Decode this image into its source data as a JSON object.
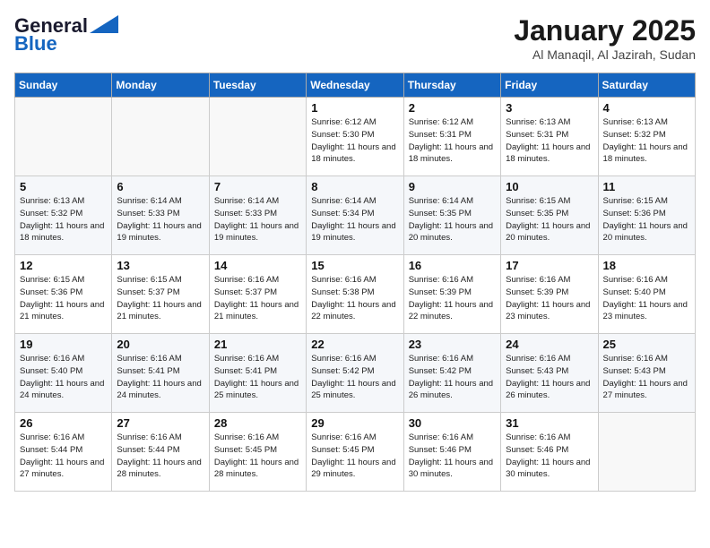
{
  "header": {
    "logo_line1": "General",
    "logo_line2": "Blue",
    "month": "January 2025",
    "location": "Al Manaqil, Al Jazirah, Sudan"
  },
  "weekdays": [
    "Sunday",
    "Monday",
    "Tuesday",
    "Wednesday",
    "Thursday",
    "Friday",
    "Saturday"
  ],
  "weeks": [
    [
      {
        "day": "",
        "empty": true
      },
      {
        "day": "",
        "empty": true
      },
      {
        "day": "",
        "empty": true
      },
      {
        "day": "1",
        "sunrise": "6:12 AM",
        "sunset": "5:30 PM",
        "daylight": "11 hours and 18 minutes."
      },
      {
        "day": "2",
        "sunrise": "6:12 AM",
        "sunset": "5:31 PM",
        "daylight": "11 hours and 18 minutes."
      },
      {
        "day": "3",
        "sunrise": "6:13 AM",
        "sunset": "5:31 PM",
        "daylight": "11 hours and 18 minutes."
      },
      {
        "day": "4",
        "sunrise": "6:13 AM",
        "sunset": "5:32 PM",
        "daylight": "11 hours and 18 minutes."
      }
    ],
    [
      {
        "day": "5",
        "sunrise": "6:13 AM",
        "sunset": "5:32 PM",
        "daylight": "11 hours and 18 minutes."
      },
      {
        "day": "6",
        "sunrise": "6:14 AM",
        "sunset": "5:33 PM",
        "daylight": "11 hours and 19 minutes."
      },
      {
        "day": "7",
        "sunrise": "6:14 AM",
        "sunset": "5:33 PM",
        "daylight": "11 hours and 19 minutes."
      },
      {
        "day": "8",
        "sunrise": "6:14 AM",
        "sunset": "5:34 PM",
        "daylight": "11 hours and 19 minutes."
      },
      {
        "day": "9",
        "sunrise": "6:14 AM",
        "sunset": "5:35 PM",
        "daylight": "11 hours and 20 minutes."
      },
      {
        "day": "10",
        "sunrise": "6:15 AM",
        "sunset": "5:35 PM",
        "daylight": "11 hours and 20 minutes."
      },
      {
        "day": "11",
        "sunrise": "6:15 AM",
        "sunset": "5:36 PM",
        "daylight": "11 hours and 20 minutes."
      }
    ],
    [
      {
        "day": "12",
        "sunrise": "6:15 AM",
        "sunset": "5:36 PM",
        "daylight": "11 hours and 21 minutes."
      },
      {
        "day": "13",
        "sunrise": "6:15 AM",
        "sunset": "5:37 PM",
        "daylight": "11 hours and 21 minutes."
      },
      {
        "day": "14",
        "sunrise": "6:16 AM",
        "sunset": "5:37 PM",
        "daylight": "11 hours and 21 minutes."
      },
      {
        "day": "15",
        "sunrise": "6:16 AM",
        "sunset": "5:38 PM",
        "daylight": "11 hours and 22 minutes."
      },
      {
        "day": "16",
        "sunrise": "6:16 AM",
        "sunset": "5:39 PM",
        "daylight": "11 hours and 22 minutes."
      },
      {
        "day": "17",
        "sunrise": "6:16 AM",
        "sunset": "5:39 PM",
        "daylight": "11 hours and 23 minutes."
      },
      {
        "day": "18",
        "sunrise": "6:16 AM",
        "sunset": "5:40 PM",
        "daylight": "11 hours and 23 minutes."
      }
    ],
    [
      {
        "day": "19",
        "sunrise": "6:16 AM",
        "sunset": "5:40 PM",
        "daylight": "11 hours and 24 minutes."
      },
      {
        "day": "20",
        "sunrise": "6:16 AM",
        "sunset": "5:41 PM",
        "daylight": "11 hours and 24 minutes."
      },
      {
        "day": "21",
        "sunrise": "6:16 AM",
        "sunset": "5:41 PM",
        "daylight": "11 hours and 25 minutes."
      },
      {
        "day": "22",
        "sunrise": "6:16 AM",
        "sunset": "5:42 PM",
        "daylight": "11 hours and 25 minutes."
      },
      {
        "day": "23",
        "sunrise": "6:16 AM",
        "sunset": "5:42 PM",
        "daylight": "11 hours and 26 minutes."
      },
      {
        "day": "24",
        "sunrise": "6:16 AM",
        "sunset": "5:43 PM",
        "daylight": "11 hours and 26 minutes."
      },
      {
        "day": "25",
        "sunrise": "6:16 AM",
        "sunset": "5:43 PM",
        "daylight": "11 hours and 27 minutes."
      }
    ],
    [
      {
        "day": "26",
        "sunrise": "6:16 AM",
        "sunset": "5:44 PM",
        "daylight": "11 hours and 27 minutes."
      },
      {
        "day": "27",
        "sunrise": "6:16 AM",
        "sunset": "5:44 PM",
        "daylight": "11 hours and 28 minutes."
      },
      {
        "day": "28",
        "sunrise": "6:16 AM",
        "sunset": "5:45 PM",
        "daylight": "11 hours and 28 minutes."
      },
      {
        "day": "29",
        "sunrise": "6:16 AM",
        "sunset": "5:45 PM",
        "daylight": "11 hours and 29 minutes."
      },
      {
        "day": "30",
        "sunrise": "6:16 AM",
        "sunset": "5:46 PM",
        "daylight": "11 hours and 30 minutes."
      },
      {
        "day": "31",
        "sunrise": "6:16 AM",
        "sunset": "5:46 PM",
        "daylight": "11 hours and 30 minutes."
      },
      {
        "day": "",
        "empty": true
      }
    ]
  ]
}
